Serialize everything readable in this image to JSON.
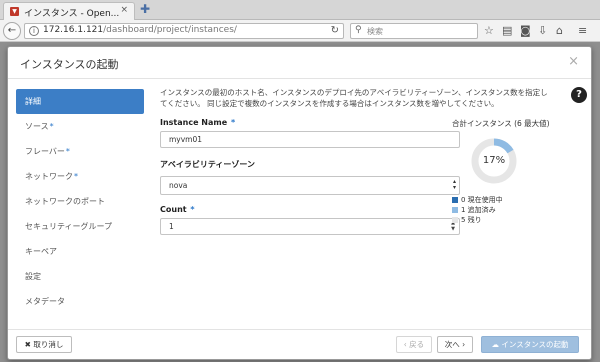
{
  "browser": {
    "tab_title": "インスタンス - Open...",
    "tab_close": "×",
    "new_tab": "✚",
    "url_host": "172.16.1.121",
    "url_path": "/dashboard/project/instances/",
    "search_placeholder": "検索"
  },
  "modal": {
    "title": "インスタンスの起動",
    "close": "×",
    "help": "?"
  },
  "sidebar": {
    "items": [
      {
        "label": "詳細",
        "required": false
      },
      {
        "label": "ソース",
        "required": true
      },
      {
        "label": "フレーバー",
        "required": true
      },
      {
        "label": "ネットワーク",
        "required": true
      },
      {
        "label": "ネットワークのポート",
        "required": false
      },
      {
        "label": "セキュリティーグループ",
        "required": false
      },
      {
        "label": "キーペア",
        "required": false
      },
      {
        "label": "設定",
        "required": false
      },
      {
        "label": "メタデータ",
        "required": false
      }
    ],
    "required_mark": "*"
  },
  "form": {
    "help_text_1": "インスタンスの最初のホスト名、インスタンスのデプロイ先のアベイラビリティーゾーン、インスタンス数を指定し",
    "help_text_2": "てください。 同じ設定で複数のインスタンスを作成する場合はインスタンス数を増やしてください。",
    "instance_name_label": "Instance Name",
    "instance_name_value": "myvm01",
    "az_label": "アベイラビリティーゾーン",
    "az_value": "nova",
    "count_label": "Count",
    "count_value": "1",
    "required_mark": "*"
  },
  "quota": {
    "title": "合計インスタンス (6 最大値)",
    "percent_label": "17%",
    "used_fraction": 0.1667,
    "legend": [
      {
        "label": "0 現在使用中",
        "color": "#2a6db0"
      },
      {
        "label": "1 追加済み",
        "color": "#8fbbe3"
      },
      {
        "label": "5 残り",
        "color": "#e6e6e6"
      }
    ]
  },
  "footer": {
    "cancel": "取り消し",
    "back": "‹ 戻る",
    "next": "次へ ›",
    "launch": "インスタンスの起動"
  }
}
